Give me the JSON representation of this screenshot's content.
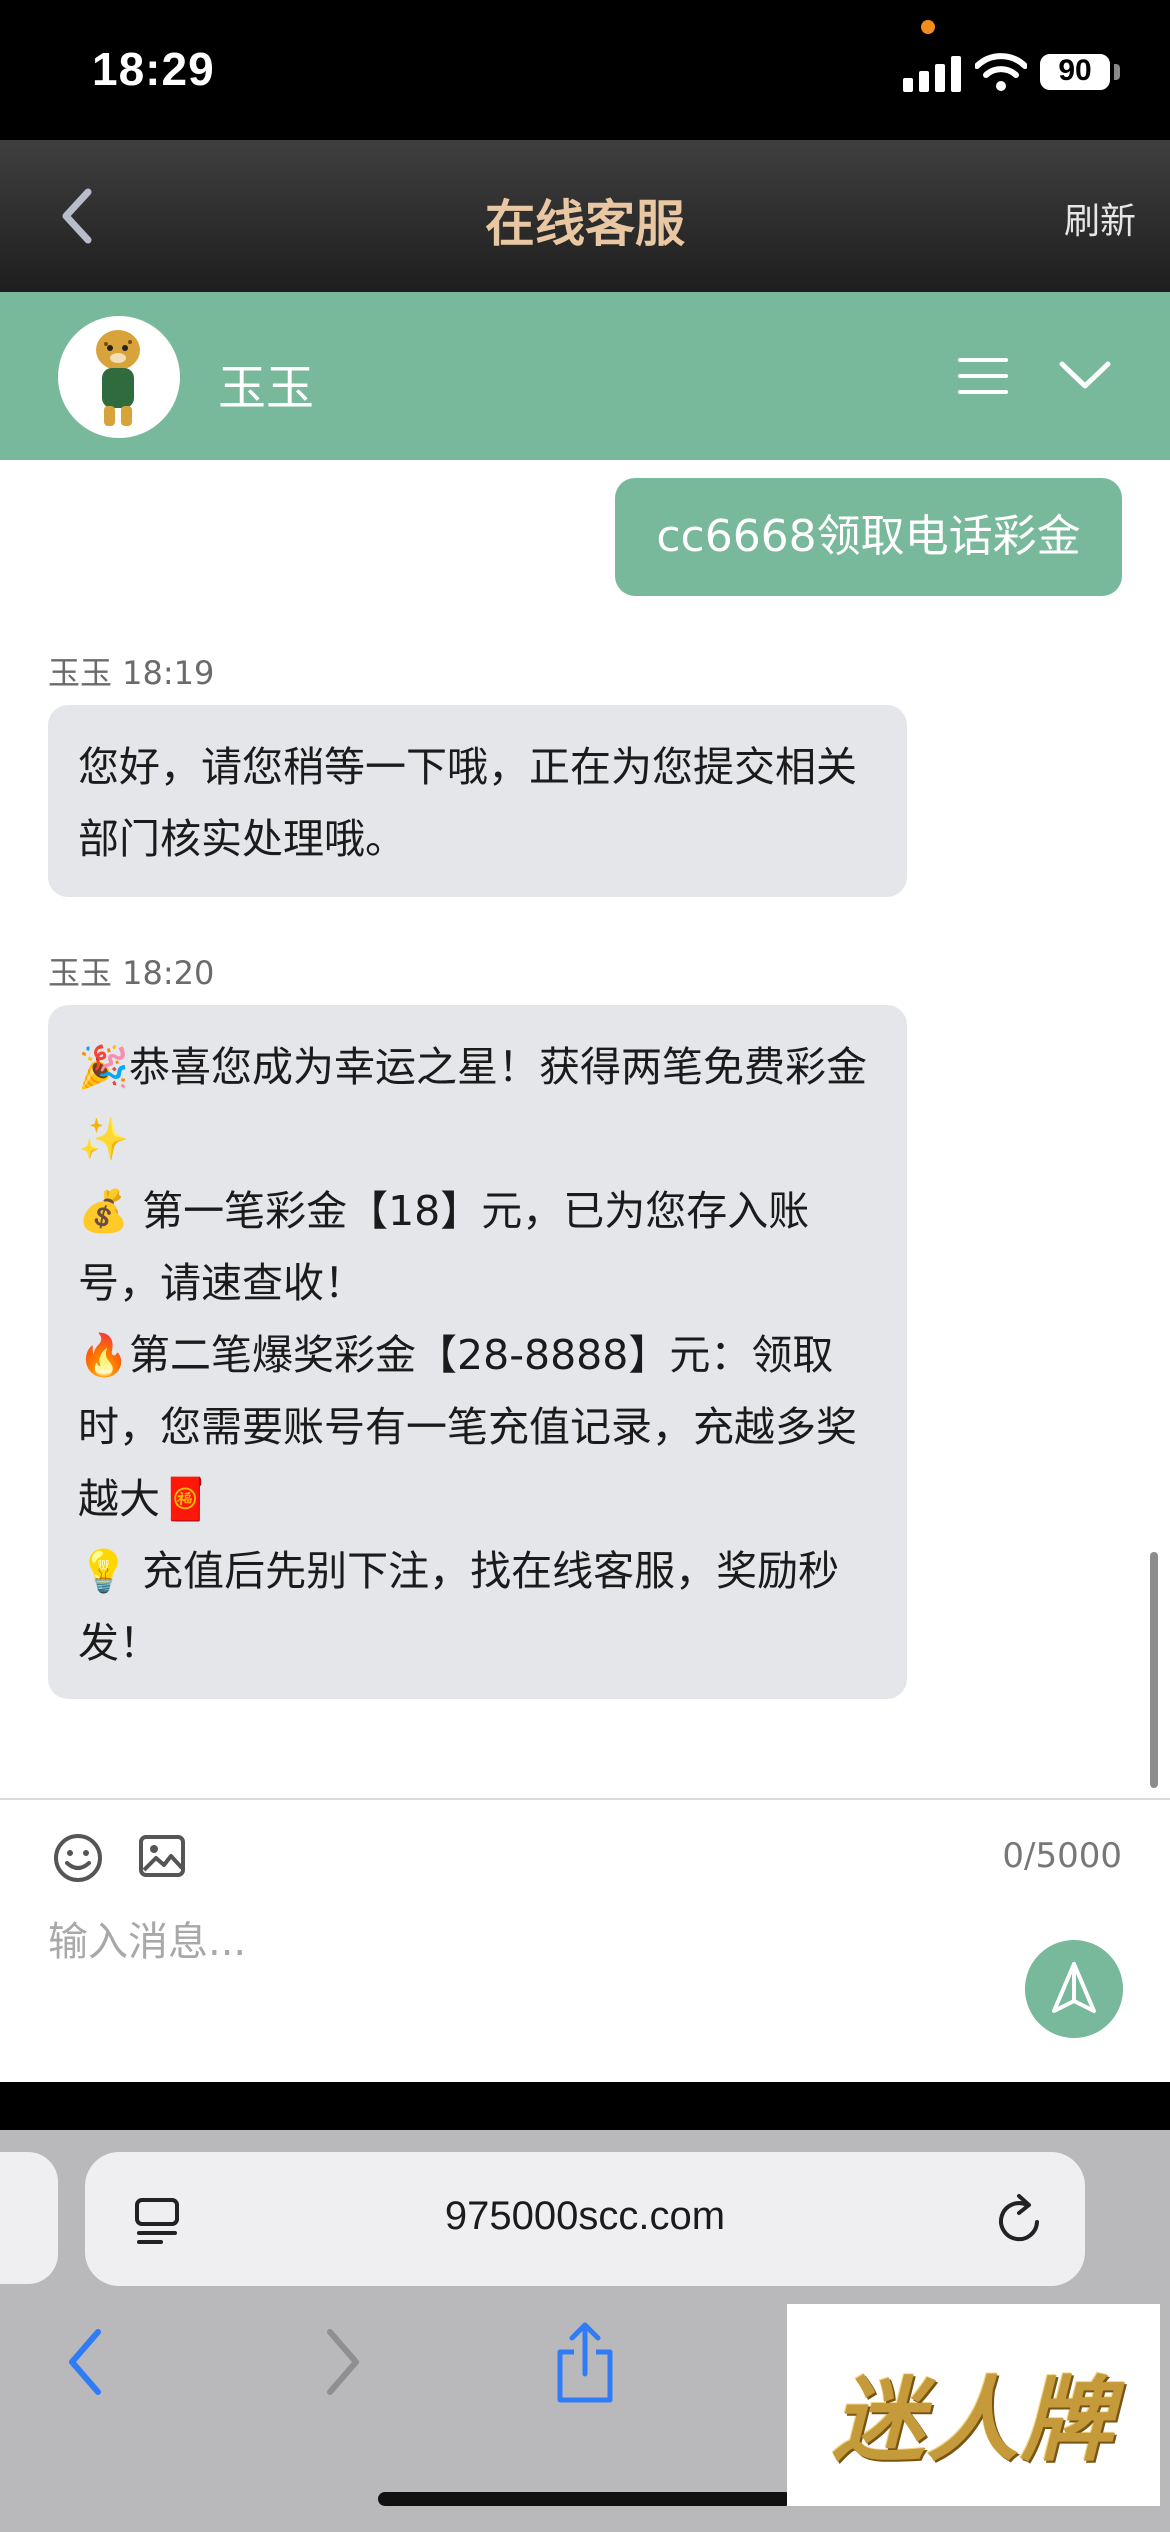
{
  "status_bar": {
    "time": "18:29",
    "battery": "90"
  },
  "nav": {
    "title": "在线客服",
    "refresh_label": "刷新"
  },
  "chat_header": {
    "agent_name": "玉玉"
  },
  "messages": {
    "user_message": "cc6668领取电话彩金",
    "first": {
      "meta": "玉玉 18:19",
      "text": "您好，请您稍等一下哦，正在为您提交相关部门核实处理哦。"
    },
    "second": {
      "meta": "玉玉 18:20",
      "text": "🎉恭喜您成为幸运之星！获得两笔免费彩金✨\n💰 第一笔彩金【18】元，已为您存入账号，请速查收！\n🔥第二笔爆奖彩金【28-8888】元：领取时，您需要账号有一笔充值记录，充越多奖越大🧧\n💡 充值后先别下注，找在线客服，奖励秒发！"
    }
  },
  "composer": {
    "char_count": "0/5000",
    "placeholder": "输入消息..."
  },
  "browser": {
    "url": "975000scc.com"
  },
  "watermark": {
    "text": "迷人牌"
  },
  "colors": {
    "accent_green": "#79b99b",
    "nav_title": "#e9c7a2"
  }
}
